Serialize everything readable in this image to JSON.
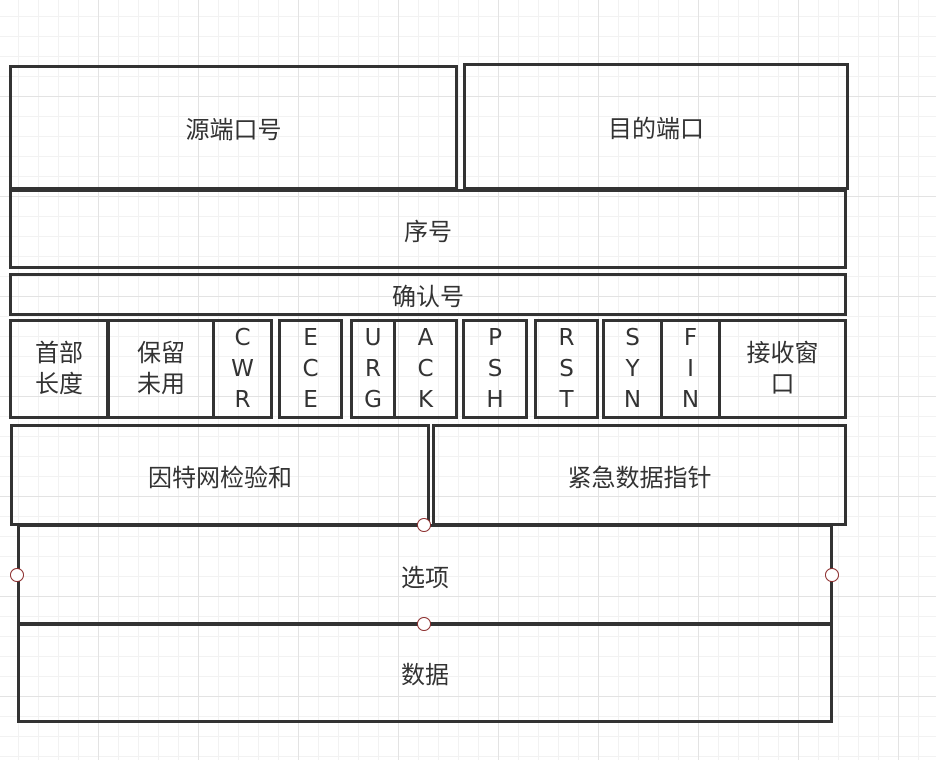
{
  "diagram": {
    "source_port": "源端口号",
    "dest_port": "目的端口",
    "sequence_number": "序号",
    "ack_number": "确认号",
    "header_length": [
      "首部",
      "长度"
    ],
    "reserved": [
      "保留",
      "未用"
    ],
    "flags": {
      "cwr": [
        "C",
        "W",
        "R"
      ],
      "ece": [
        "E",
        "C",
        "E"
      ],
      "urg": [
        "U",
        "R",
        "G"
      ],
      "ack": [
        "A",
        "C",
        "K"
      ],
      "psh": [
        "P",
        "S",
        "H"
      ],
      "rst": [
        "R",
        "S",
        "T"
      ],
      "syn": [
        "S",
        "Y",
        "N"
      ],
      "fin": [
        "F",
        "I",
        "N"
      ]
    },
    "receive_window": [
      "接收窗",
      "口"
    ],
    "checksum": "因特网检验和",
    "urgent_pointer": "紧急数据指针",
    "options": "选项",
    "data": "数据"
  }
}
